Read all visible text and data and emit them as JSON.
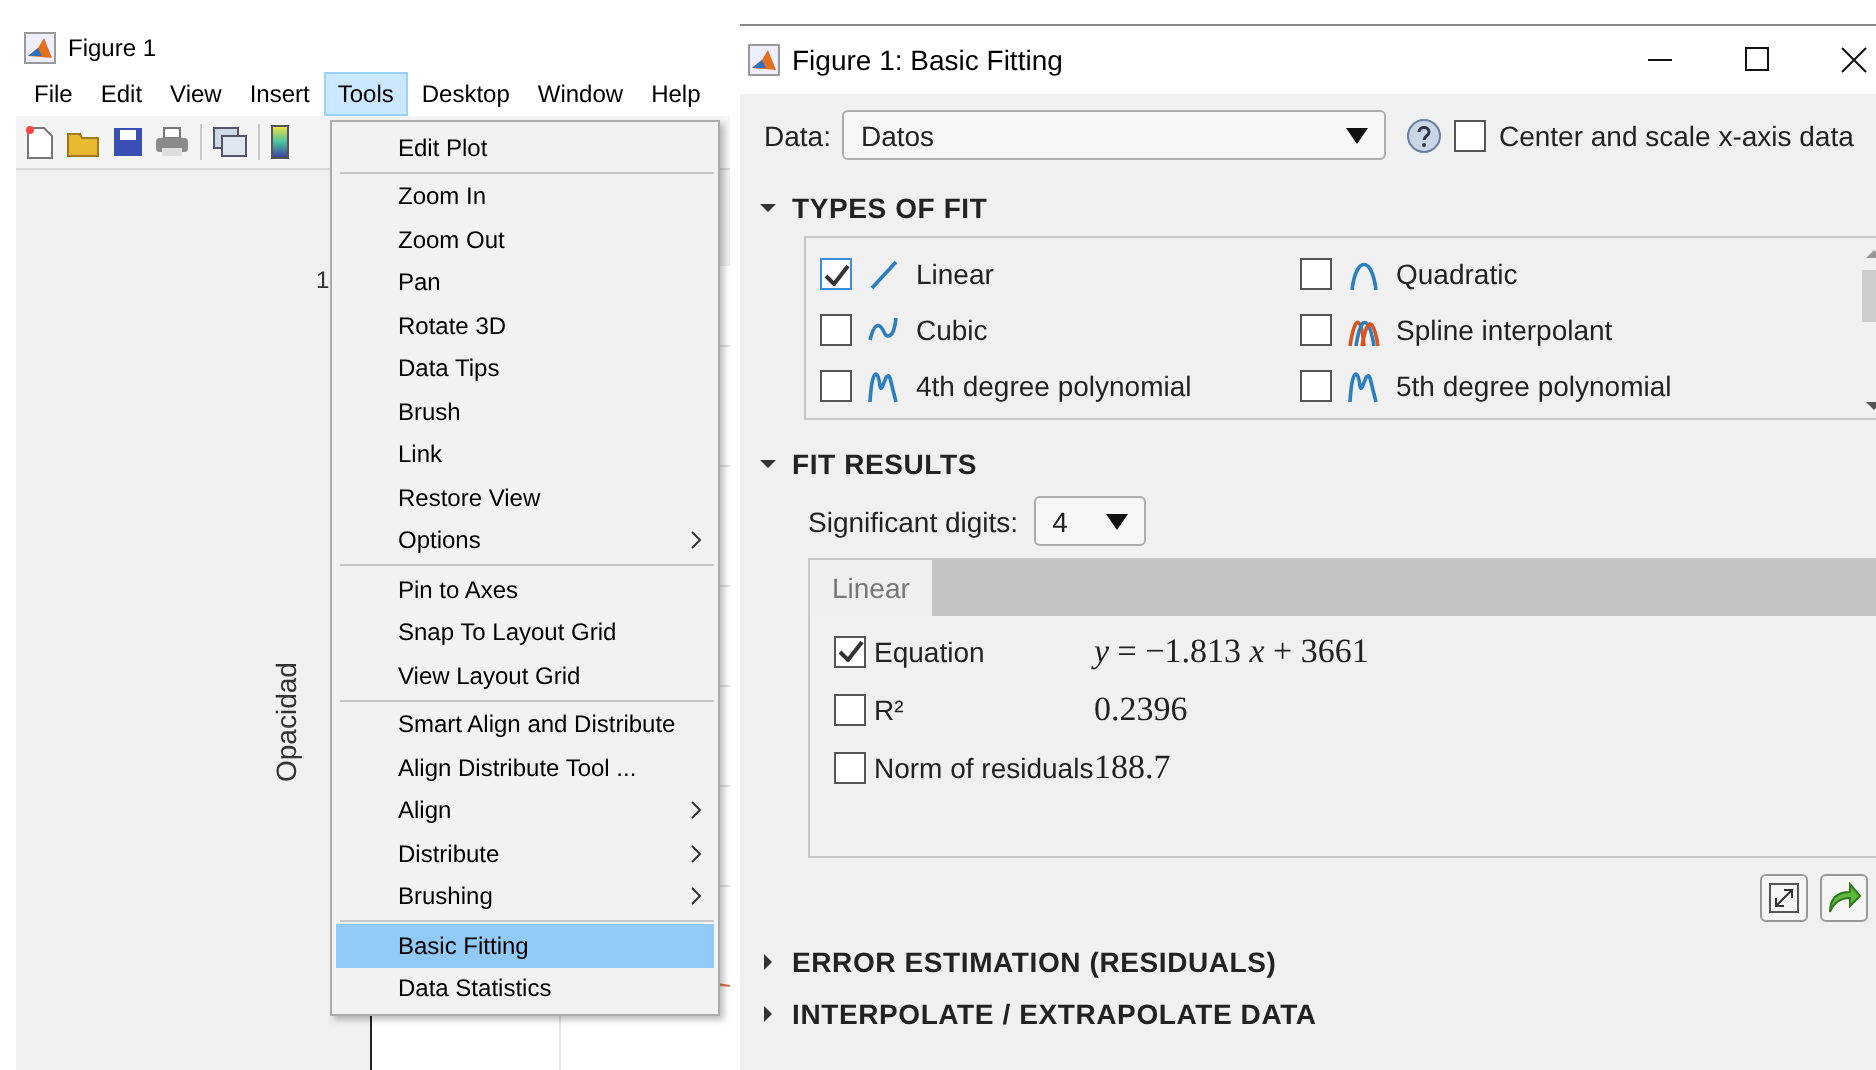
{
  "figure_window": {
    "title": "Figure 1",
    "menu_bar": [
      {
        "label": "File",
        "selected": false
      },
      {
        "label": "Edit",
        "selected": false
      },
      {
        "label": "View",
        "selected": false
      },
      {
        "label": "Insert",
        "selected": false
      },
      {
        "label": "Tools",
        "selected": true
      },
      {
        "label": "Desktop",
        "selected": false
      },
      {
        "label": "Window",
        "selected": false
      },
      {
        "label": "Help",
        "selected": false
      }
    ],
    "toolbar": [
      {
        "kind": "new"
      },
      {
        "kind": "open"
      },
      {
        "kind": "save"
      },
      {
        "kind": "print"
      },
      {
        "kind": "separator"
      },
      {
        "kind": "link"
      },
      {
        "kind": "separator"
      },
      {
        "kind": "colorbar"
      }
    ],
    "axes": {
      "ytick": "1",
      "ylabel": "Opacidad"
    },
    "tools_menu": [
      {
        "items": [
          {
            "label": "Edit Plot",
            "submenu": false,
            "selected": false
          }
        ]
      },
      {
        "items": [
          {
            "label": "Zoom In",
            "submenu": false,
            "selected": false
          },
          {
            "label": "Zoom Out",
            "submenu": false,
            "selected": false
          },
          {
            "label": "Pan",
            "submenu": false,
            "selected": false
          },
          {
            "label": "Rotate 3D",
            "submenu": false,
            "selected": false
          },
          {
            "label": "Data Tips",
            "submenu": false,
            "selected": false
          },
          {
            "label": "Brush",
            "submenu": false,
            "selected": false
          },
          {
            "label": "Link",
            "submenu": false,
            "selected": false
          },
          {
            "label": "Restore View",
            "submenu": false,
            "selected": false
          },
          {
            "label": "Options",
            "submenu": true,
            "selected": false
          }
        ]
      },
      {
        "items": [
          {
            "label": "Pin to Axes",
            "submenu": false,
            "selected": false
          },
          {
            "label": "Snap To Layout Grid",
            "submenu": false,
            "selected": false
          },
          {
            "label": "View Layout Grid",
            "submenu": false,
            "selected": false
          }
        ]
      },
      {
        "items": [
          {
            "label": "Smart Align and Distribute",
            "submenu": false,
            "selected": false
          },
          {
            "label": "Align Distribute Tool ...",
            "submenu": false,
            "selected": false
          },
          {
            "label": "Align",
            "submenu": true,
            "selected": false
          },
          {
            "label": "Distribute",
            "submenu": true,
            "selected": false
          },
          {
            "label": "Brushing",
            "submenu": true,
            "selected": false
          }
        ]
      },
      {
        "items": [
          {
            "label": "Basic Fitting",
            "submenu": false,
            "selected": true
          },
          {
            "label": "Data Statistics",
            "submenu": false,
            "selected": false
          }
        ]
      }
    ]
  },
  "fitting_window": {
    "title": "Figure 1: Basic Fitting",
    "data": {
      "label": "Data:",
      "value": "Datos"
    },
    "center_scale": {
      "label": "Center and scale x-axis data",
      "checked": false
    },
    "types_of_fit": {
      "title": "TYPES OF FIT",
      "expanded": true,
      "items": [
        {
          "label": "Linear",
          "kind": "linear",
          "checked": true
        },
        {
          "label": "Quadratic",
          "kind": "quadratic",
          "checked": false
        },
        {
          "label": "Cubic",
          "kind": "cubic",
          "checked": false
        },
        {
          "label": "Spline interpolant",
          "kind": "spline",
          "checked": false
        },
        {
          "label": "4th degree polynomial",
          "kind": "poly",
          "checked": false
        },
        {
          "label": "5th degree polynomial",
          "kind": "poly",
          "checked": false
        }
      ]
    },
    "fit_results": {
      "title": "FIT RESULTS",
      "expanded": true,
      "significant_digits": {
        "label": "Significant digits:",
        "value": "4"
      },
      "tab": "Linear",
      "rows": [
        {
          "label": "Equation",
          "checked": true,
          "value": "*y* = −1.813 *x* + 3661"
        },
        {
          "label": "R²",
          "checked": false,
          "value": "0.2396"
        },
        {
          "label": "Norm of residuals",
          "checked": false,
          "value": "188.7"
        }
      ]
    },
    "sections": [
      {
        "title": "ERROR ESTIMATION (RESIDUALS)",
        "expanded": false
      },
      {
        "title": "INTERPOLATE / EXTRAPOLATE DATA",
        "expanded": false
      }
    ]
  }
}
